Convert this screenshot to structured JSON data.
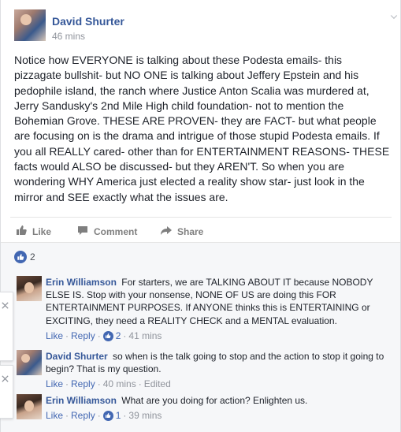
{
  "post": {
    "author": "David Shurter",
    "timestamp": "46 mins",
    "text": "Notice how EVERYONE is talking about these Podesta emails- this pizzagate bullshit- but NO ONE is talking about Jeffery Epstein and his pedophile island, the ranch where Justice Anton Scalia was murdered at, Jerry Sandusky's 2nd Mile High child foundation- not to mention the Bohemian Grove. THESE ARE PROVEN- they are FACT- but what people are focusing on is the drama and intrigue of those stupid Podesta emails. If you all REALLY cared- other than for ENTERTAINMENT REASONS- THESE facts would ALSO be discussed- but they AREN'T. So when you are wondering WHY America just elected a reality show star- just look in the mirror and SEE exactly what the issues are."
  },
  "actions": {
    "like": "Like",
    "comment": "Comment",
    "share": "Share"
  },
  "reactions": {
    "count": "2"
  },
  "comments": [
    {
      "author": "Erin Williamson",
      "text": "For starters, we are TALKING ABOUT IT because NOBODY ELSE IS. Stop with your nonsense, NONE OF US are doing this FOR ENTERTAINMENT PURPOSES. If ANYONE thinks this is ENTERTAINING or EXCITING, they need a REALITY CHECK and a MENTAL evaluation.",
      "like": "Like",
      "reply": "Reply",
      "likes": "2",
      "time": "41 mins"
    },
    {
      "author": "David Shurter",
      "text": "so when is the talk going to stop and the action to stop it going to begin? That is my question.",
      "like": "Like",
      "reply": "Reply",
      "time": "40 mins",
      "edited": "Edited"
    },
    {
      "author": "Erin Williamson",
      "text": "What are you doing for action? Enlighten us.",
      "like": "Like",
      "reply": "Reply",
      "likes": "1",
      "time": "39 mins"
    }
  ],
  "icons": {
    "like": "thumbs-up-icon",
    "comment": "speech-bubble-icon",
    "share": "share-arrow-icon",
    "options": "chevron-down-icon",
    "close": "close-icon"
  },
  "colors": {
    "link": "#365899",
    "accent": "#4267b2",
    "muted": "#90949c"
  }
}
